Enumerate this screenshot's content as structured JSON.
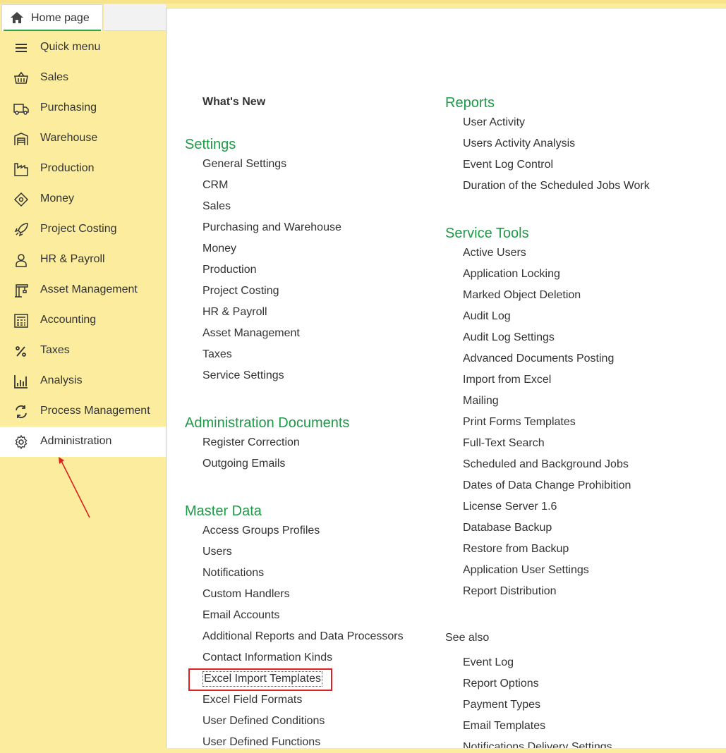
{
  "tab": {
    "home_label": "Home page"
  },
  "sidebar": {
    "items": [
      {
        "label": "Quick menu",
        "icon": "hamburger-icon"
      },
      {
        "label": "Sales",
        "icon": "basket-icon"
      },
      {
        "label": "Purchasing",
        "icon": "truck-icon"
      },
      {
        "label": "Warehouse",
        "icon": "warehouse-icon"
      },
      {
        "label": "Production",
        "icon": "factory-icon"
      },
      {
        "label": "Money",
        "icon": "money-tag-icon"
      },
      {
        "label": "Project Costing",
        "icon": "rocket-icon"
      },
      {
        "label": "HR & Payroll",
        "icon": "person-icon"
      },
      {
        "label": "Asset Management",
        "icon": "crane-icon"
      },
      {
        "label": "Accounting",
        "icon": "calculator-icon"
      },
      {
        "label": "Taxes",
        "icon": "percent-icon"
      },
      {
        "label": "Analysis",
        "icon": "bar-chart-icon"
      },
      {
        "label": "Process Management",
        "icon": "cycle-icon"
      },
      {
        "label": "Administration",
        "icon": "gear-icon",
        "active": true
      }
    ]
  },
  "main": {
    "whats_new": "What's New",
    "settings": {
      "title": "Settings",
      "items": [
        "General Settings",
        "CRM",
        "Sales",
        "Purchasing and Warehouse",
        "Money",
        "Production",
        "Project Costing",
        "HR & Payroll",
        "Asset Management",
        "Taxes",
        "Service Settings"
      ]
    },
    "admin_docs": {
      "title": "Administration Documents",
      "items": [
        "Register Correction",
        "Outgoing Emails"
      ]
    },
    "master_data": {
      "title": "Master Data",
      "items": [
        "Access Groups Profiles",
        "Users",
        "Notifications",
        "Custom Handlers",
        "Email Accounts",
        "Additional Reports and Data Processors",
        "Contact Information Kinds",
        "Excel Import Templates",
        "Excel Field Formats",
        "User Defined Conditions",
        "User Defined Functions"
      ]
    },
    "reports": {
      "title": "Reports",
      "items": [
        "User Activity",
        "Users Activity Analysis",
        "Event Log Control",
        "Duration of the Scheduled Jobs Work"
      ]
    },
    "service_tools": {
      "title": "Service Tools",
      "items": [
        "Active Users",
        "Application Locking",
        "Marked Object Deletion",
        "Audit Log",
        "Audit Log Settings",
        "Advanced Documents Posting",
        "Import from Excel",
        "Mailing",
        "Print Forms Templates",
        "Full-Text Search",
        "Scheduled and Background Jobs",
        "Dates of Data Change Prohibition",
        "License Server 1.6",
        "Database Backup",
        "Restore from Backup",
        "Application User Settings",
        "Report Distribution"
      ]
    },
    "see_also": {
      "title": "See also",
      "items": [
        "Event Log",
        "Report Options",
        "Payment Types",
        "Email Templates",
        "Notifications Delivery Settings"
      ]
    }
  },
  "colors": {
    "sidebar_bg": "#fbec9e",
    "section_title": "#1e9a46",
    "highlight_box": "#e02020",
    "active_tab_underline": "#28a350"
  }
}
